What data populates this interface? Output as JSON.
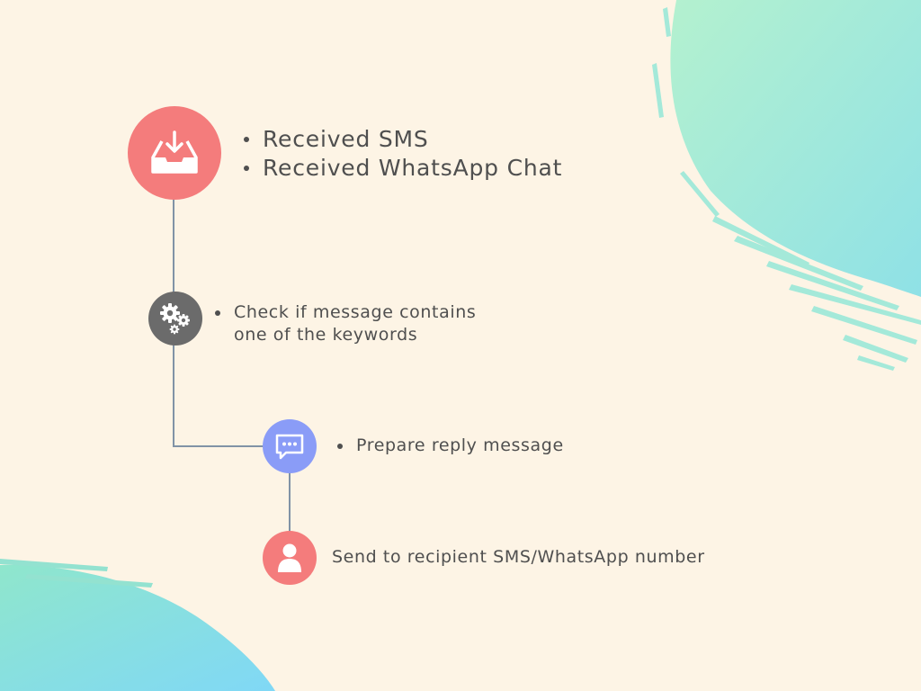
{
  "colors": {
    "background": "#fdf4e5",
    "node_inbox": "#f47c7c",
    "node_gear": "#6b6b6b",
    "node_chat": "#8a9cf7",
    "node_user": "#f47c7c",
    "connector": "#8193a6",
    "text": "#4f4f4f",
    "accent_teal": "#8ee3d3",
    "accent_blue": "#80ddf2"
  },
  "steps": [
    {
      "icon": "inbox-download-icon",
      "lines": [
        "Received SMS",
        "Received WhatsApp Chat"
      ]
    },
    {
      "icon": "gears-icon",
      "lines": [
        "Check if message contains one of the keywords"
      ]
    },
    {
      "icon": "chat-bubble-icon",
      "lines": [
        "Prepare reply message"
      ]
    },
    {
      "icon": "user-icon",
      "text": "Send to recipient SMS/WhatsApp number"
    }
  ]
}
